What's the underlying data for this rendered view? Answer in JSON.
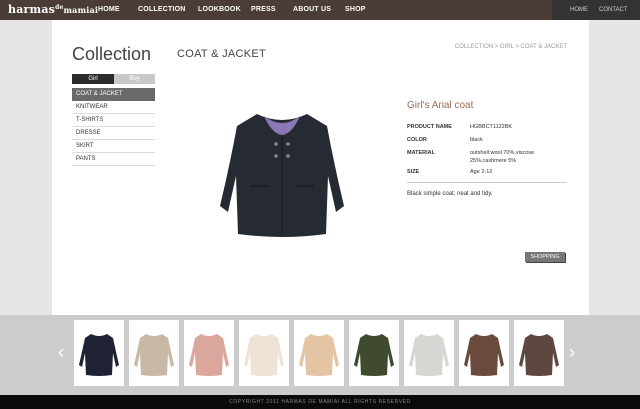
{
  "logo": {
    "brand": "harmas",
    "sup": "de",
    "sub": "mamiai"
  },
  "nav": [
    "HOME",
    "COLLECTION",
    "LOOKBOOK",
    "PRESS",
    "ABOUT US",
    "SHOP"
  ],
  "util_nav": [
    "HOME",
    "CONTACT"
  ],
  "sidebar": {
    "title": "Collection",
    "gender_tabs": [
      "Girl",
      "Boy"
    ],
    "categories": [
      "COAT & JACKET",
      "KNITWEAR",
      "T-SHIRTS",
      "DRESSE",
      "SKIRT",
      "PANTS"
    ]
  },
  "page_title": "COAT & JACKET",
  "breadcrumb": "COLLECTION > GIRL > COAT & JACKET",
  "product": {
    "name": "Girl's Arial coat",
    "specs": [
      {
        "label": "PRODUCT NAME",
        "value": "HGBBCT1122BK"
      },
      {
        "label": "COLOR",
        "value": "black"
      },
      {
        "label": "MATERIAL",
        "value": "outshell:wool 70%,viscose 25%,cashmere 5%"
      },
      {
        "label": "SIZE",
        "value": "Age 2-12"
      }
    ],
    "description": "Black simple coat; neat and tidy.",
    "shopping_label": "SHOPPING"
  },
  "thumbnails": [
    {
      "color": "#1f2233"
    },
    {
      "color": "#c8b8a6"
    },
    {
      "color": "#d9a79b"
    },
    {
      "color": "#eee3d4"
    },
    {
      "color": "#e3c4a3"
    },
    {
      "color": "#3f4a2f"
    },
    {
      "color": "#d8d6d2"
    },
    {
      "color": "#6b4a3e"
    },
    {
      "color": "#5e4740"
    }
  ],
  "copyright": "COPYRIGHT 2011 HARMAS DE MAMIAI ALL RIGHTS RESERVED"
}
